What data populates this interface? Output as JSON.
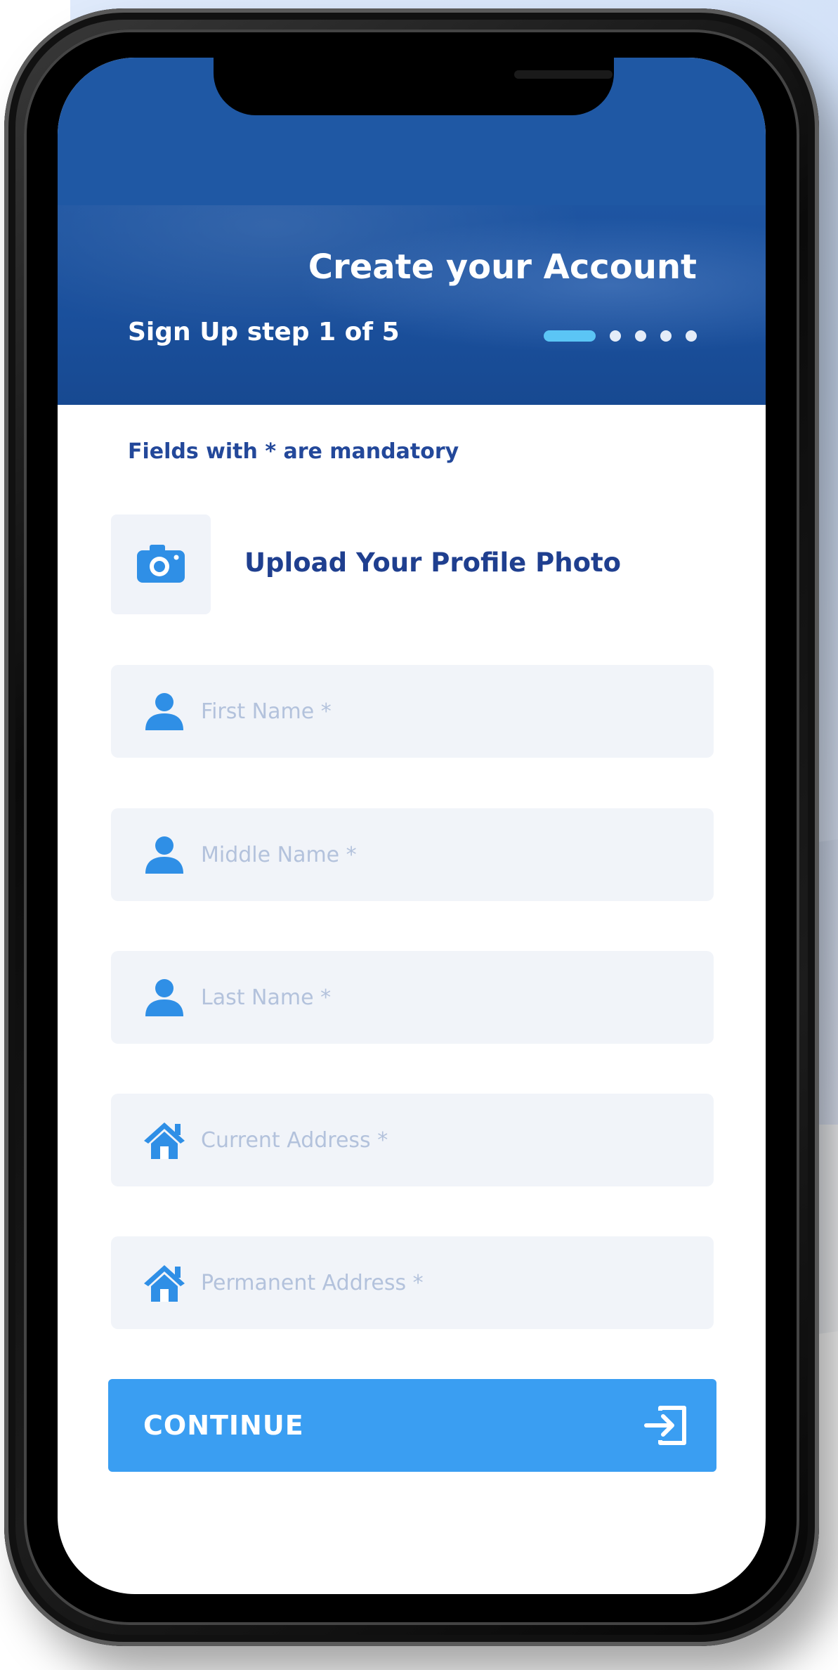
{
  "header": {
    "title": "Create your Account",
    "step_text": "Sign Up step 1 of 5",
    "step_current": 1,
    "step_total": 5
  },
  "form": {
    "mandatory_note": "Fields with * are mandatory",
    "upload_label": "Upload Your Profile Photo",
    "fields": [
      {
        "placeholder": "First Name *",
        "icon": "user-icon"
      },
      {
        "placeholder": "Middle Name *",
        "icon": "user-icon"
      },
      {
        "placeholder": "Last Name *",
        "icon": "user-icon"
      },
      {
        "placeholder": "Current Address *",
        "icon": "home-icon"
      },
      {
        "placeholder": "Permanent Address *",
        "icon": "home-icon"
      }
    ],
    "continue_label": "CONTINUE",
    "continue_icon": "sign-in-icon"
  },
  "colors": {
    "header_blue": "#1f58a4",
    "accent": "#3a9ef2",
    "active_dot": "#5bc5f5",
    "icon_blue": "#2f8fe6"
  }
}
